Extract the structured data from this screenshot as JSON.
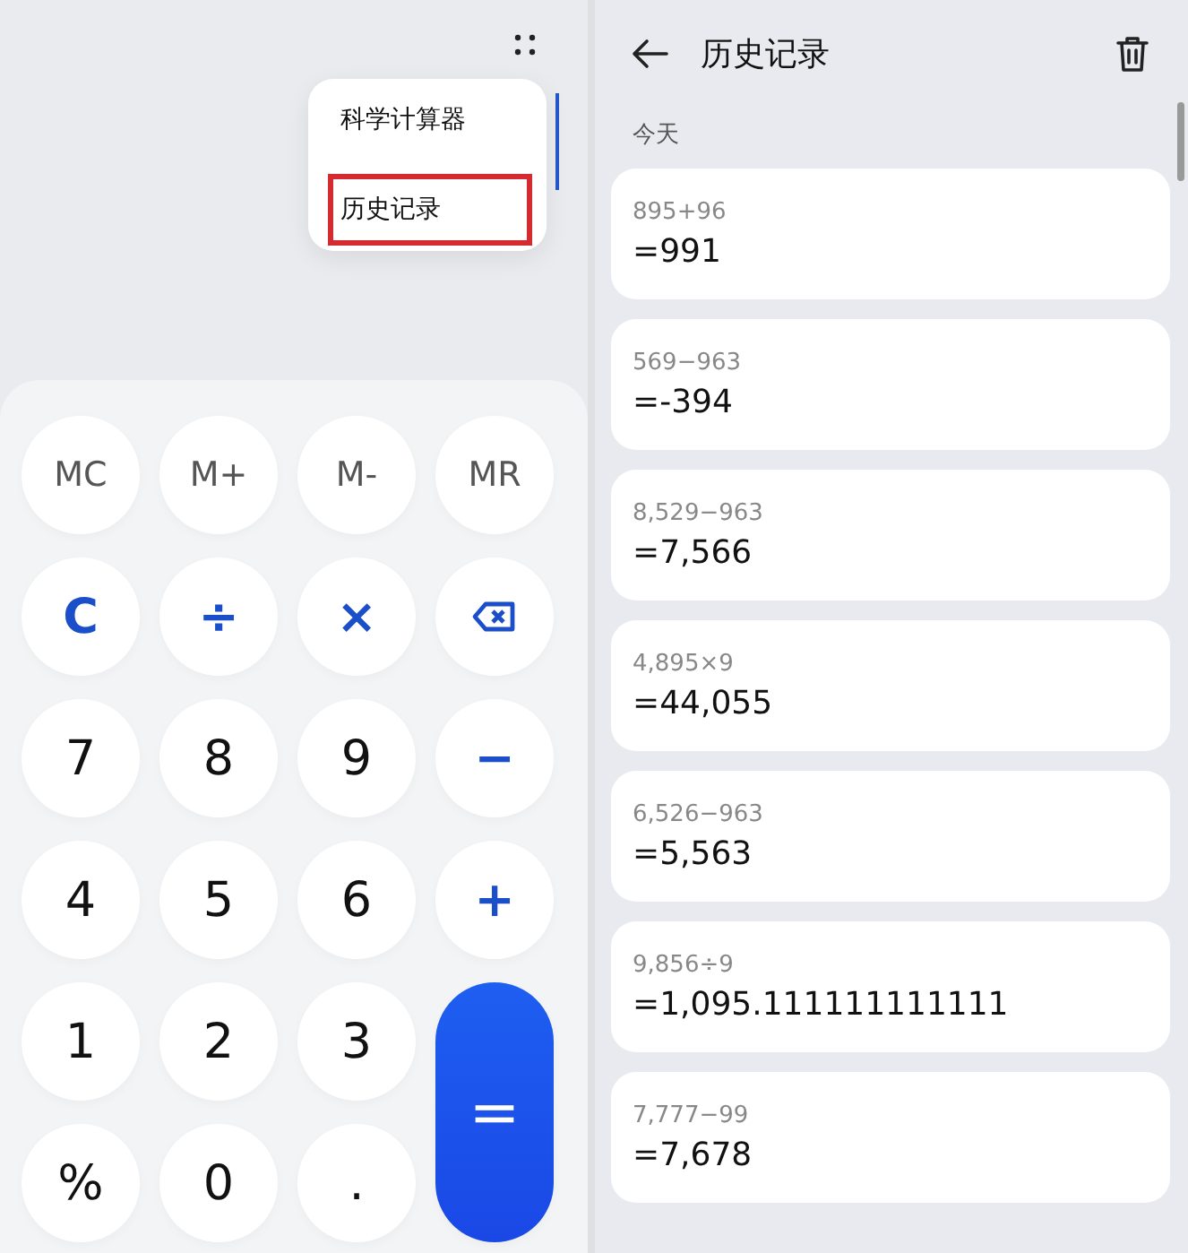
{
  "calculator": {
    "menu": {
      "items": [
        {
          "label": "科学计算器",
          "highlighted": false
        },
        {
          "label": "历史记录",
          "highlighted": true
        }
      ]
    },
    "keys": [
      {
        "label": "MC",
        "kind": "memory"
      },
      {
        "label": "M+",
        "kind": "memory"
      },
      {
        "label": "M-",
        "kind": "memory"
      },
      {
        "label": "MR",
        "kind": "memory"
      },
      {
        "label": "C",
        "kind": "operator"
      },
      {
        "label": "÷",
        "kind": "operator"
      },
      {
        "label": "×",
        "kind": "operator"
      },
      {
        "kind": "backspace"
      },
      {
        "label": "7",
        "kind": "digit"
      },
      {
        "label": "8",
        "kind": "digit"
      },
      {
        "label": "9",
        "kind": "digit"
      },
      {
        "label": "−",
        "kind": "operator"
      },
      {
        "label": "4",
        "kind": "digit"
      },
      {
        "label": "5",
        "kind": "digit"
      },
      {
        "label": "6",
        "kind": "digit"
      },
      {
        "label": "+",
        "kind": "operator"
      },
      {
        "label": "1",
        "kind": "digit"
      },
      {
        "label": "2",
        "kind": "digit"
      },
      {
        "label": "3",
        "kind": "digit"
      },
      {
        "label": "=",
        "kind": "equals"
      },
      {
        "label": "%",
        "kind": "digit"
      },
      {
        "label": "0",
        "kind": "digit"
      },
      {
        "label": ".",
        "kind": "digit"
      }
    ]
  },
  "history": {
    "title": "历史记录",
    "section": "今天",
    "entries": [
      {
        "expression": "895+96",
        "result": "=991"
      },
      {
        "expression": "569−963",
        "result": "=-394"
      },
      {
        "expression": "8,529−963",
        "result": "=7,566"
      },
      {
        "expression": "4,895×9",
        "result": "=44,055"
      },
      {
        "expression": "6,526−963",
        "result": "=5,563"
      },
      {
        "expression": "9,856÷9",
        "result": "=1,095.111111111111"
      },
      {
        "expression": "7,777−99",
        "result": "=7,678"
      }
    ]
  }
}
